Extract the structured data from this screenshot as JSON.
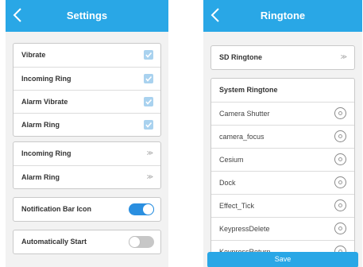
{
  "colors": {
    "accent": "#29a7e6",
    "toggle_on": "#2a8fe0",
    "checkbox": "#a9d2ef"
  },
  "settings": {
    "title": "Settings",
    "checkbox_rows": [
      {
        "label": "Vibrate",
        "checked": true
      },
      {
        "label": "Incoming Ring",
        "checked": true
      },
      {
        "label": "Alarm Vibrate",
        "checked": true
      },
      {
        "label": "Alarm Ring",
        "checked": true
      }
    ],
    "link_rows": [
      {
        "label": "Incoming Ring",
        "chevron": "≫"
      },
      {
        "label": "Alarm Ring",
        "chevron": "≫"
      }
    ],
    "notification_bar_icon": {
      "label": "Notification Bar Icon",
      "on": true
    },
    "automatically_start": {
      "label": "Automatically Start",
      "on": false
    }
  },
  "ringtone": {
    "title": "Ringtone",
    "sd_ringtone": {
      "label": "SD Ringtone",
      "chevron": "≫"
    },
    "system_header": "System Ringtone",
    "system_items": [
      "Camera Shutter",
      "camera_focus",
      "Cesium",
      "Dock",
      "Effect_Tick",
      "KeypressDelete",
      "KeypressReturn"
    ],
    "save_label": "Save"
  }
}
